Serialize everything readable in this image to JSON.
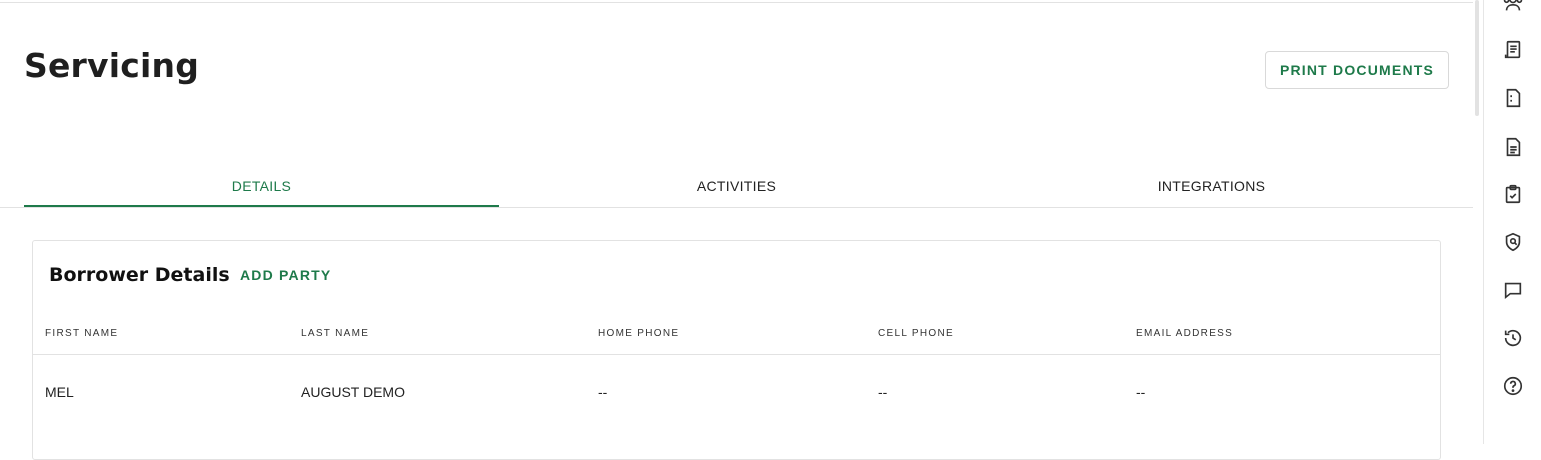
{
  "page": {
    "title": "Servicing"
  },
  "actions": {
    "print_label": "PRINT DOCUMENTS"
  },
  "tabs": [
    {
      "label": "DETAILS",
      "active": true
    },
    {
      "label": "ACTIVITIES",
      "active": false
    },
    {
      "label": "INTEGRATIONS",
      "active": false
    }
  ],
  "borrower": {
    "title": "Borrower Details",
    "add_label": "ADD PARTY",
    "columns": [
      "FIRST NAME",
      "LAST NAME",
      "HOME PHONE",
      "CELL PHONE",
      "EMAIL ADDRESS"
    ],
    "rows": [
      [
        "MEL",
        "AUGUST DEMO",
        "--",
        "--",
        "--"
      ]
    ]
  },
  "rail": {
    "icons": [
      "users-icon",
      "receipt-icon",
      "document-dashed-icon",
      "document-lines-icon",
      "clipboard-check-icon",
      "shield-search-icon",
      "chat-icon",
      "history-icon",
      "help-icon"
    ]
  },
  "colors": {
    "accent": "#1e7a4a",
    "border": "#e2e2e2"
  }
}
